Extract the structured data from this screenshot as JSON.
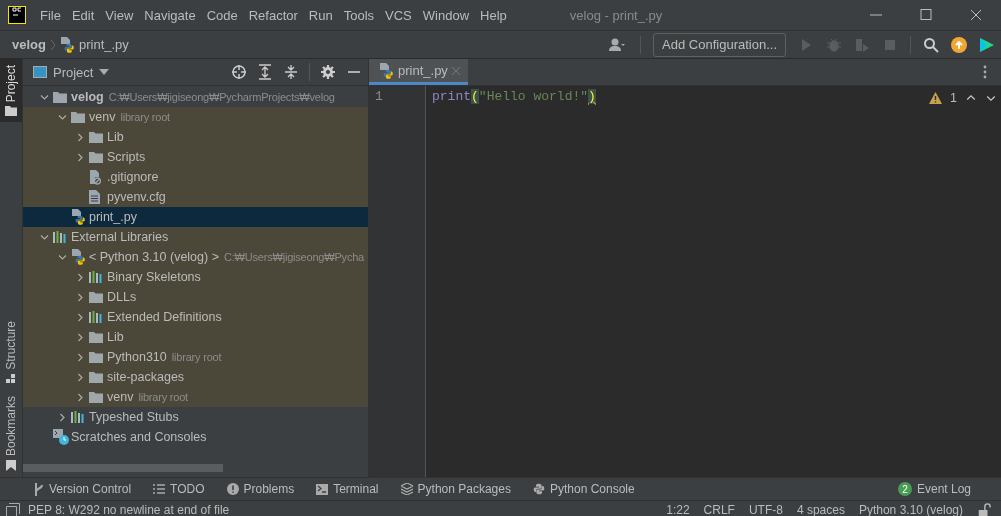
{
  "window": {
    "title": "velog - print_.py"
  },
  "menu": [
    "File",
    "Edit",
    "View",
    "Navigate",
    "Code",
    "Refactor",
    "Run",
    "Tools",
    "VCS",
    "Window",
    "Help"
  ],
  "breadcrumb": [
    {
      "label": "velog",
      "kind": "project"
    },
    {
      "label": "print_.py",
      "kind": "python"
    }
  ],
  "toolbar": {
    "config_button": "Add Configuration..."
  },
  "side_tabs": {
    "top": [
      {
        "label": "Project",
        "kind": "folder",
        "selected": true
      }
    ],
    "bottom": [
      {
        "label": "Structure",
        "kind": "structure",
        "selected": false
      },
      {
        "label": "Bookmarks",
        "kind": "bookmark",
        "selected": false
      }
    ]
  },
  "project_panel": {
    "title": "Project",
    "tree": [
      {
        "label": "velog",
        "hint": "C:₩Users₩jigiseong₩PycharmProjects₩velog",
        "kind": "folder",
        "bold": true,
        "expanded": true,
        "selected": false,
        "highlighted": false,
        "children": [
          {
            "label": "venv",
            "hint": "library root",
            "kind": "folder",
            "expanded": true,
            "selected": false,
            "highlighted": true,
            "children": [
              {
                "label": "Lib",
                "kind": "folder",
                "expanded": false,
                "selected": false,
                "highlighted": true
              },
              {
                "label": "Scripts",
                "kind": "folder",
                "expanded": false,
                "selected": false,
                "highlighted": true
              },
              {
                "label": ".gitignore",
                "kind": "ignored-file",
                "selected": false,
                "highlighted": true
              },
              {
                "label": "pyvenv.cfg",
                "kind": "text-file",
                "selected": false,
                "highlighted": true
              }
            ]
          },
          {
            "label": "print_.py",
            "kind": "python",
            "selected": true,
            "highlighted": false
          }
        ]
      },
      {
        "label": "External Libraries",
        "kind": "library",
        "expanded": true,
        "selected": false,
        "highlighted": true,
        "children": [
          {
            "label": "< Python 3.10 (velog) >",
            "hint": "C:₩Users₩jigiseong₩Pycha",
            "kind": "python",
            "expanded": true,
            "selected": false,
            "highlighted": true,
            "children": [
              {
                "label": "Binary Skeletons",
                "kind": "library",
                "expanded": false,
                "selected": false,
                "highlighted": true
              },
              {
                "label": "DLLs",
                "kind": "folder",
                "expanded": false,
                "selected": false,
                "highlighted": true
              },
              {
                "label": "Extended Definitions",
                "kind": "library",
                "expanded": false,
                "selected": false,
                "highlighted": true
              },
              {
                "label": "Lib",
                "kind": "folder",
                "expanded": false,
                "selected": false,
                "highlighted": true
              },
              {
                "label": "Python310",
                "hint": "library root",
                "kind": "folder",
                "expanded": false,
                "selected": false,
                "highlighted": true
              },
              {
                "label": "site-packages",
                "kind": "folder",
                "expanded": false,
                "selected": false,
                "highlighted": true
              },
              {
                "label": "venv",
                "hint": "library root",
                "kind": "folder",
                "expanded": false,
                "selected": false,
                "highlighted": true
              }
            ]
          },
          {
            "label": "Typeshed Stubs",
            "kind": "library",
            "expanded": false,
            "selected": false,
            "highlighted": false
          }
        ]
      },
      {
        "label": "Scratches and Consoles",
        "kind": "scratches",
        "selected": false,
        "highlighted": false
      }
    ]
  },
  "editor": {
    "tabs": [
      {
        "label": "print_.py",
        "selected": true
      }
    ],
    "lines": [
      {
        "number": "1",
        "tokens": [
          {
            "text": "print",
            "kind": "function",
            "matched": false,
            "warning": false
          },
          {
            "text": "(",
            "kind": "paren",
            "matched": true,
            "warning": false
          },
          {
            "text": "\"Hello world!\"",
            "kind": "string",
            "matched": false,
            "warning": false
          },
          {
            "text": ")",
            "kind": "paren",
            "matched": true,
            "warning": true
          }
        ]
      }
    ],
    "inspection": {
      "count": "1"
    }
  },
  "tool_windows": [
    {
      "label": "Version Control",
      "kind": "vcs"
    },
    {
      "label": "TODO",
      "kind": "list"
    },
    {
      "label": "Problems",
      "kind": "problems"
    },
    {
      "label": "Terminal",
      "kind": "terminal"
    },
    {
      "label": "Python Packages",
      "kind": "packages"
    },
    {
      "label": "Python Console",
      "kind": "python"
    }
  ],
  "event_log": {
    "label": "Event Log",
    "badge": "2"
  },
  "status_bar": {
    "message": "PEP 8: W292 no newline at end of file",
    "items": [
      "1:22",
      "CRLF",
      "UTF-8",
      "4 spaces",
      "Python 3.10 (velog)"
    ]
  }
}
